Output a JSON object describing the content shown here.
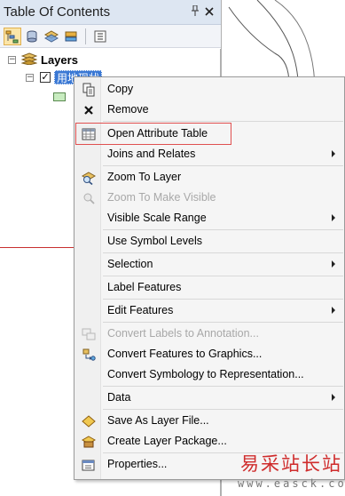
{
  "toc": {
    "title": "Table Of Contents",
    "pin_icon": "pin-icon",
    "close_icon": "close-icon",
    "toolbar": {
      "buttons": [
        "list-by-drawing-order-icon",
        "list-by-source-icon",
        "list-by-visibility-icon",
        "list-by-selection-icon",
        "options-icon"
      ]
    },
    "tree": {
      "root_label": "Layers",
      "layer_name": "用地现状",
      "expander_root": "⊟",
      "expander_layer": "⊟",
      "checkmark": "✓"
    }
  },
  "context_menu": {
    "items": [
      {
        "label": "Copy",
        "icon": "copy-icon",
        "enabled": true,
        "submenu": false
      },
      {
        "label": "Remove",
        "icon": "remove-icon",
        "enabled": true,
        "submenu": false
      },
      {
        "label": "Open Attribute Table",
        "icon": "table-icon",
        "enabled": true,
        "submenu": false
      },
      {
        "label": "Joins and Relates",
        "icon": "",
        "enabled": true,
        "submenu": true
      },
      {
        "label": "Zoom To Layer",
        "icon": "zoom-to-layer-icon",
        "enabled": true,
        "submenu": false
      },
      {
        "label": "Zoom To Make Visible",
        "icon": "zoom-visible-icon",
        "enabled": false,
        "submenu": false
      },
      {
        "label": "Visible Scale Range",
        "icon": "",
        "enabled": true,
        "submenu": true
      },
      {
        "label": "Use Symbol Levels",
        "icon": "",
        "enabled": true,
        "submenu": false
      },
      {
        "label": "Selection",
        "icon": "",
        "enabled": true,
        "submenu": true
      },
      {
        "label": "Label Features",
        "icon": "",
        "enabled": true,
        "submenu": false
      },
      {
        "label": "Edit Features",
        "icon": "",
        "enabled": true,
        "submenu": true
      },
      {
        "label": "Convert Labels to Annotation...",
        "icon": "convert-labels-icon",
        "enabled": false,
        "submenu": false
      },
      {
        "label": "Convert Features to Graphics...",
        "icon": "convert-features-icon",
        "enabled": true,
        "submenu": false
      },
      {
        "label": "Convert Symbology to Representation...",
        "icon": "",
        "enabled": true,
        "submenu": false
      },
      {
        "label": "Data",
        "icon": "",
        "enabled": true,
        "submenu": true
      },
      {
        "label": "Save As Layer File...",
        "icon": "layer-file-icon",
        "enabled": true,
        "submenu": false
      },
      {
        "label": "Create Layer Package...",
        "icon": "layer-package-icon",
        "enabled": true,
        "submenu": false
      },
      {
        "label": "Properties...",
        "icon": "properties-icon",
        "enabled": true,
        "submenu": false
      }
    ],
    "highlighted_item": "Open Attribute Table"
  },
  "watermark": {
    "brand": "易采站长站",
    "url": "www.easck.com"
  },
  "colors": {
    "title_bar": "#dde6f2",
    "selection_blue": "#3a78d4",
    "highlight_red": "#e05050",
    "watermark_red": "#cf2c2c",
    "disabled_text": "#a8a8a8"
  }
}
